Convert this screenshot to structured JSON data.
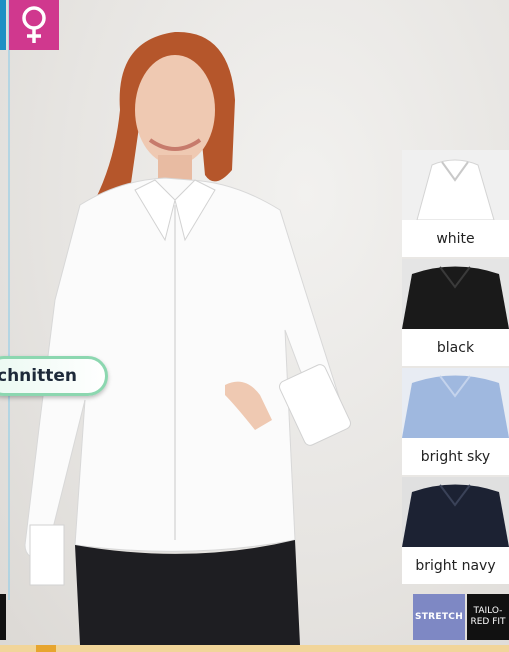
{
  "badge": {
    "icon": "female-symbol-icon",
    "color": "#d0388e"
  },
  "cut_label": "chnitten",
  "swatches": [
    {
      "label": "white",
      "color": "#f4f4f4"
    },
    {
      "label": "black",
      "color": "#1a1a1a"
    },
    {
      "label": "bright sky",
      "color": "#9fb8df"
    },
    {
      "label": "bright navy",
      "color": "#1c2233"
    }
  ],
  "tags": {
    "stretch": "STRETCH",
    "tailored_line1": "TAILO-",
    "tailored_line2": "RED FIT"
  },
  "colors": {
    "accent_blue": "#1d8fc4",
    "stretch_bg": "#7e88c4",
    "bottom_bar": "#f1d59a"
  }
}
